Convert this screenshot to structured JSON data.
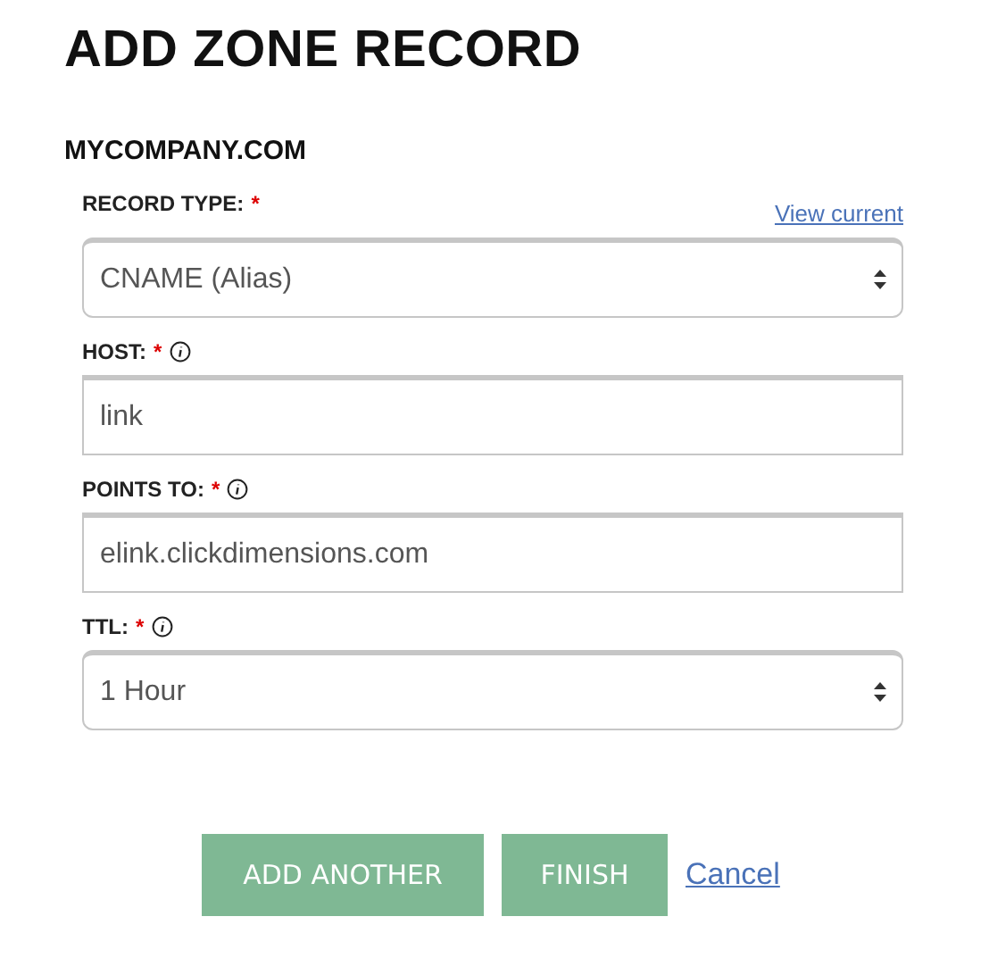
{
  "title": "ADD ZONE RECORD",
  "domain": "MYCOMPANY.COM",
  "view_link": "View current",
  "fields": [
    {
      "kind": "select",
      "label": "RECORD TYPE:",
      "required_mark": "*",
      "info": false,
      "value": "CNAME (Alias)"
    },
    {
      "kind": "input",
      "label": "HOST:",
      "required_mark": "*",
      "info": true,
      "value": "link"
    },
    {
      "kind": "input",
      "label": "POINTS TO:",
      "required_mark": "*",
      "info": true,
      "value": "elink.clickdimensions.com"
    },
    {
      "kind": "select",
      "label": "TTL:",
      "required_mark": "*",
      "info": true,
      "value": "1 Hour"
    }
  ],
  "buttons": [
    {
      "label": "ADD ANOTHER",
      "disabled": true
    },
    {
      "label": "FINISH",
      "disabled": true
    }
  ],
  "cancel_link": "Cancel"
}
